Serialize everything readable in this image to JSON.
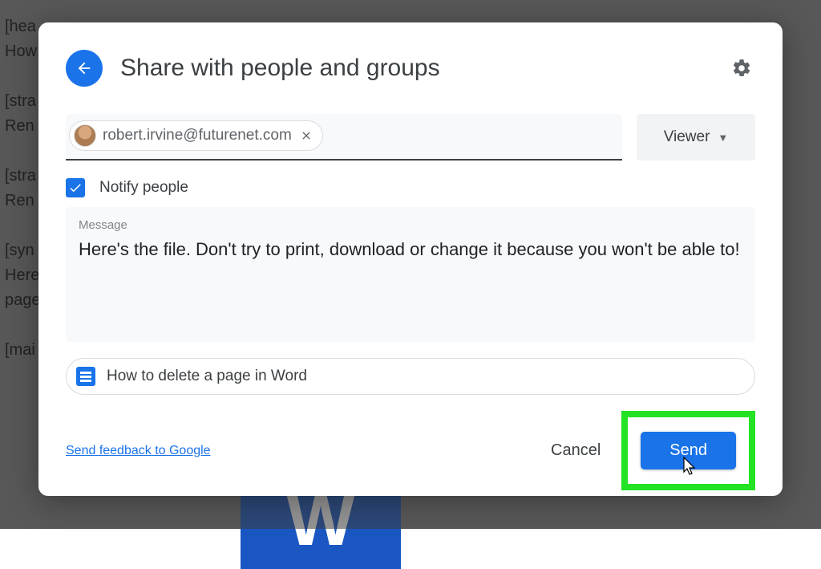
{
  "background": {
    "lines": "[hea\nHow\n\n[stra\nRen\n\n[stra\nRen\n\n[syn\nHere\npage\n\n[mai",
    "word_letter": "W"
  },
  "dialog": {
    "title": "Share with people and groups",
    "recipient": {
      "email": "robert.irvine@futurenet.com"
    },
    "role": {
      "selected": "Viewer"
    },
    "notify": {
      "label": "Notify people",
      "checked": true
    },
    "message": {
      "caption": "Message",
      "text": "Here's the file. Don't try to print, download or change it because you won't be able to!"
    },
    "attachment": {
      "name": "How to delete a page in Word"
    },
    "footer": {
      "feedback": "Send feedback to Google",
      "cancel": "Cancel",
      "send": "Send"
    }
  }
}
